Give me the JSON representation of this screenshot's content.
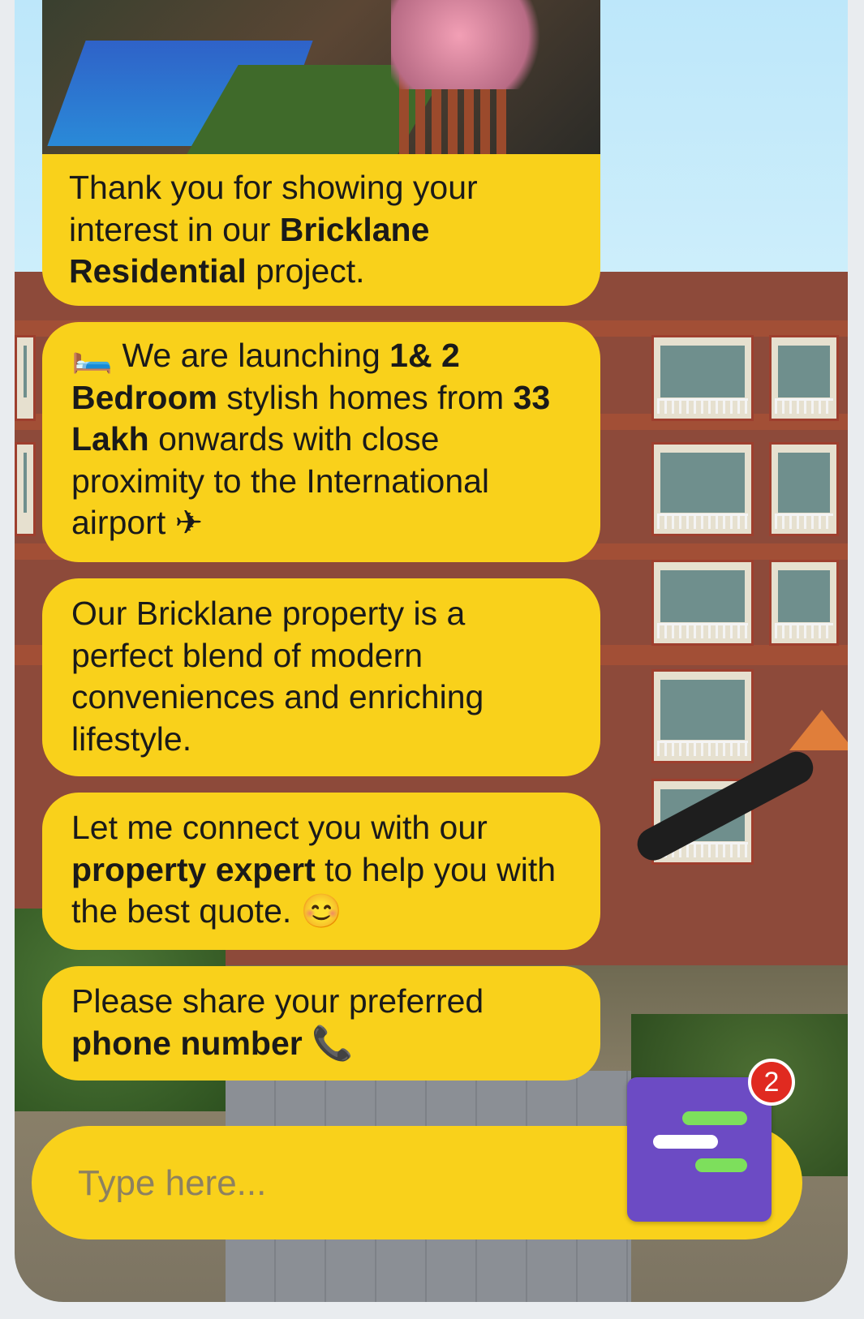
{
  "chat": {
    "messages": [
      {
        "parts": [
          {
            "text": "Thank you for showing your interest in our ",
            "bold": false
          },
          {
            "text": "Bricklane Residential",
            "bold": true
          },
          {
            "text": " project.",
            "bold": false
          }
        ]
      },
      {
        "parts": [
          {
            "text": "🛏️ We are launching ",
            "bold": false
          },
          {
            "text": "1& 2 Bedroom",
            "bold": true
          },
          {
            "text": " stylish homes from ",
            "bold": false
          },
          {
            "text": "33 Lakh",
            "bold": true
          },
          {
            "text": " onwards with close proximity to the International airport ✈",
            "bold": false
          }
        ]
      },
      {
        "parts": [
          {
            "text": "Our Bricklane property is a perfect blend of modern conveniences and enriching lifestyle.",
            "bold": false
          }
        ]
      },
      {
        "parts": [
          {
            "text": "Let me connect you with our ",
            "bold": false
          },
          {
            "text": "property expert",
            "bold": true
          },
          {
            "text": " to help you with the best quote. 😊",
            "bold": false
          }
        ]
      },
      {
        "parts": [
          {
            "text": "Please share your preferred ",
            "bold": false
          },
          {
            "text": "phone number",
            "bold": true
          },
          {
            "text": " 📞",
            "bold": false
          }
        ]
      }
    ]
  },
  "input": {
    "placeholder": "Type here..."
  },
  "launcher": {
    "icon": "chat-menu-icon",
    "badge_count": "2"
  },
  "colors": {
    "bubble": "#f9d11b",
    "launcher": "#6c4bc4",
    "badge": "#e02a20",
    "accent_green": "#7ddf5c"
  }
}
